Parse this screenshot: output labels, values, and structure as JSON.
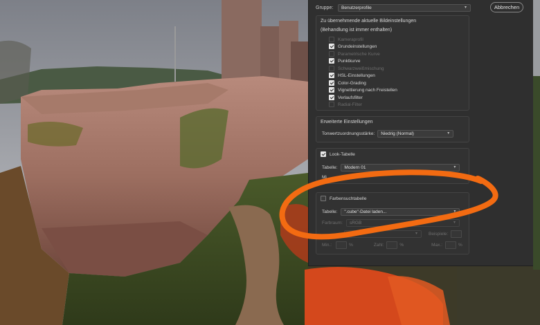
{
  "dialog": {
    "group_label": "Gruppe:",
    "group_value": "Benutzerprofile",
    "cancel_label": "Abbrechen",
    "current_settings": {
      "title": "Zu übernehmende aktuelle Bildeinstellungen",
      "subtitle": "(Behandlung ist immer enthalten)",
      "items": [
        {
          "label": "Kameraprofil",
          "checked": false,
          "disabled": true
        },
        {
          "label": "Grundeinstellungen",
          "checked": true,
          "disabled": false
        },
        {
          "label": "Parametrische Kurve",
          "checked": false,
          "disabled": true
        },
        {
          "label": "Punktkurve",
          "checked": true,
          "disabled": false
        },
        {
          "label": "Schwarzweißmischung",
          "checked": false,
          "disabled": true
        },
        {
          "label": "HSL-Einstellungen",
          "checked": true,
          "disabled": false
        },
        {
          "label": "Color-Grading",
          "checked": true,
          "disabled": false
        },
        {
          "label": "Vignettierung nach Freistellen",
          "checked": true,
          "disabled": false
        },
        {
          "label": "Verlaufsfilter",
          "checked": true,
          "disabled": false
        },
        {
          "label": "Radial-Filter",
          "checked": false,
          "disabled": true
        }
      ]
    },
    "advanced": {
      "title": "Erweiterte Einstellungen",
      "tone_label": "Tonwertzuordnungsstärke:",
      "tone_value": "Niedrig (Normal)"
    },
    "look_table": {
      "label": "Look-Tabelle",
      "checked": true,
      "table_label": "Tabelle:",
      "table_value": "Modern 01",
      "min_label": "Mi"
    },
    "color_lookup": {
      "label": "Farbensuchtabelle",
      "checked": false,
      "table_label": "Tabelle:",
      "table_value": "\".cube\"-Datei laden...",
      "space_label": "Farbraum:",
      "space_value": "sRGB",
      "resolution_value": "",
      "samples_label": "Beispiele:",
      "min_label": "Min.:",
      "num_label": "Zahl:",
      "max_label": "Max.:",
      "pct": "%"
    }
  },
  "colors": {
    "annotation_stroke": "#f36b12",
    "panel_bg": "#2f2f2f"
  }
}
